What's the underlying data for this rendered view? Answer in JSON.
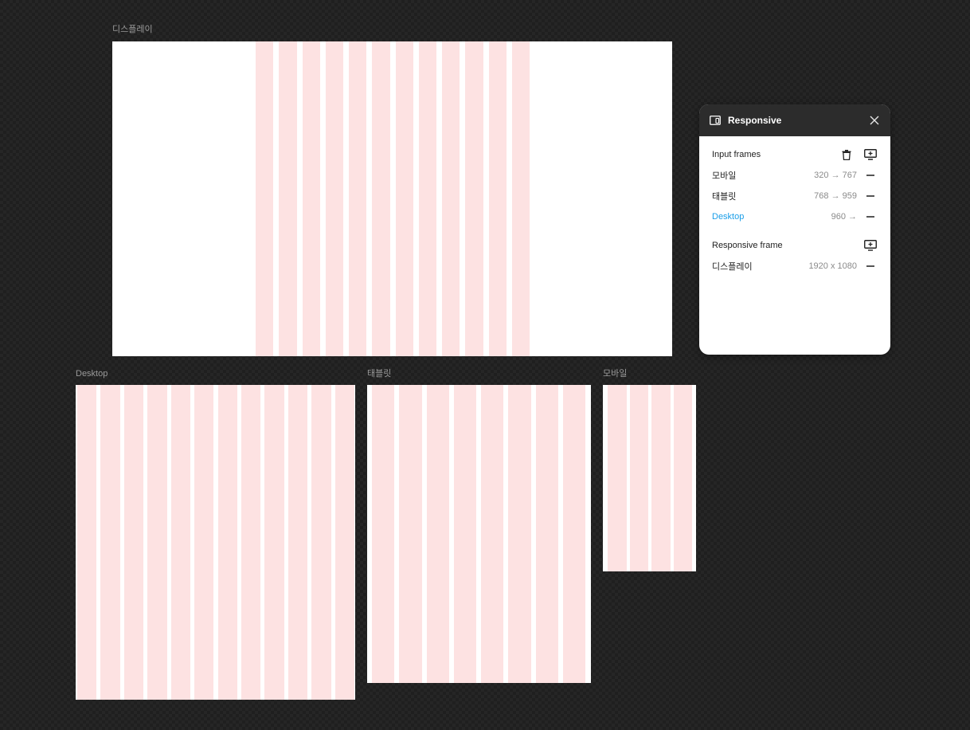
{
  "canvas": {
    "frames": [
      {
        "id": "display",
        "label": "디스플레이",
        "columns": 12
      },
      {
        "id": "desktop",
        "label": "Desktop",
        "columns": 12
      },
      {
        "id": "tablet",
        "label": "태블릿",
        "columns": 8
      },
      {
        "id": "mobile",
        "label": "모바일",
        "columns": 4
      }
    ],
    "column_color": "#fde2e2"
  },
  "panel": {
    "title": "Responsive",
    "app_icon": "responsive-devices-icon",
    "close_icon": "close-icon",
    "input_frames": {
      "title": "Input frames",
      "delete_icon": "trash-icon",
      "add_icon": "add-frame-icon",
      "items": [
        {
          "name": "모바일",
          "range": "320 → 767",
          "active": false
        },
        {
          "name": "태블릿",
          "range": "768 → 959",
          "active": false
        },
        {
          "name": "Desktop",
          "range": "960 →",
          "active": true
        }
      ]
    },
    "responsive_frame": {
      "title": "Responsive frame",
      "add_icon": "add-frame-icon",
      "items": [
        {
          "name": "디스플레이",
          "size": "1920 x 1080"
        }
      ]
    },
    "accent_color": "#1a9ee8"
  }
}
